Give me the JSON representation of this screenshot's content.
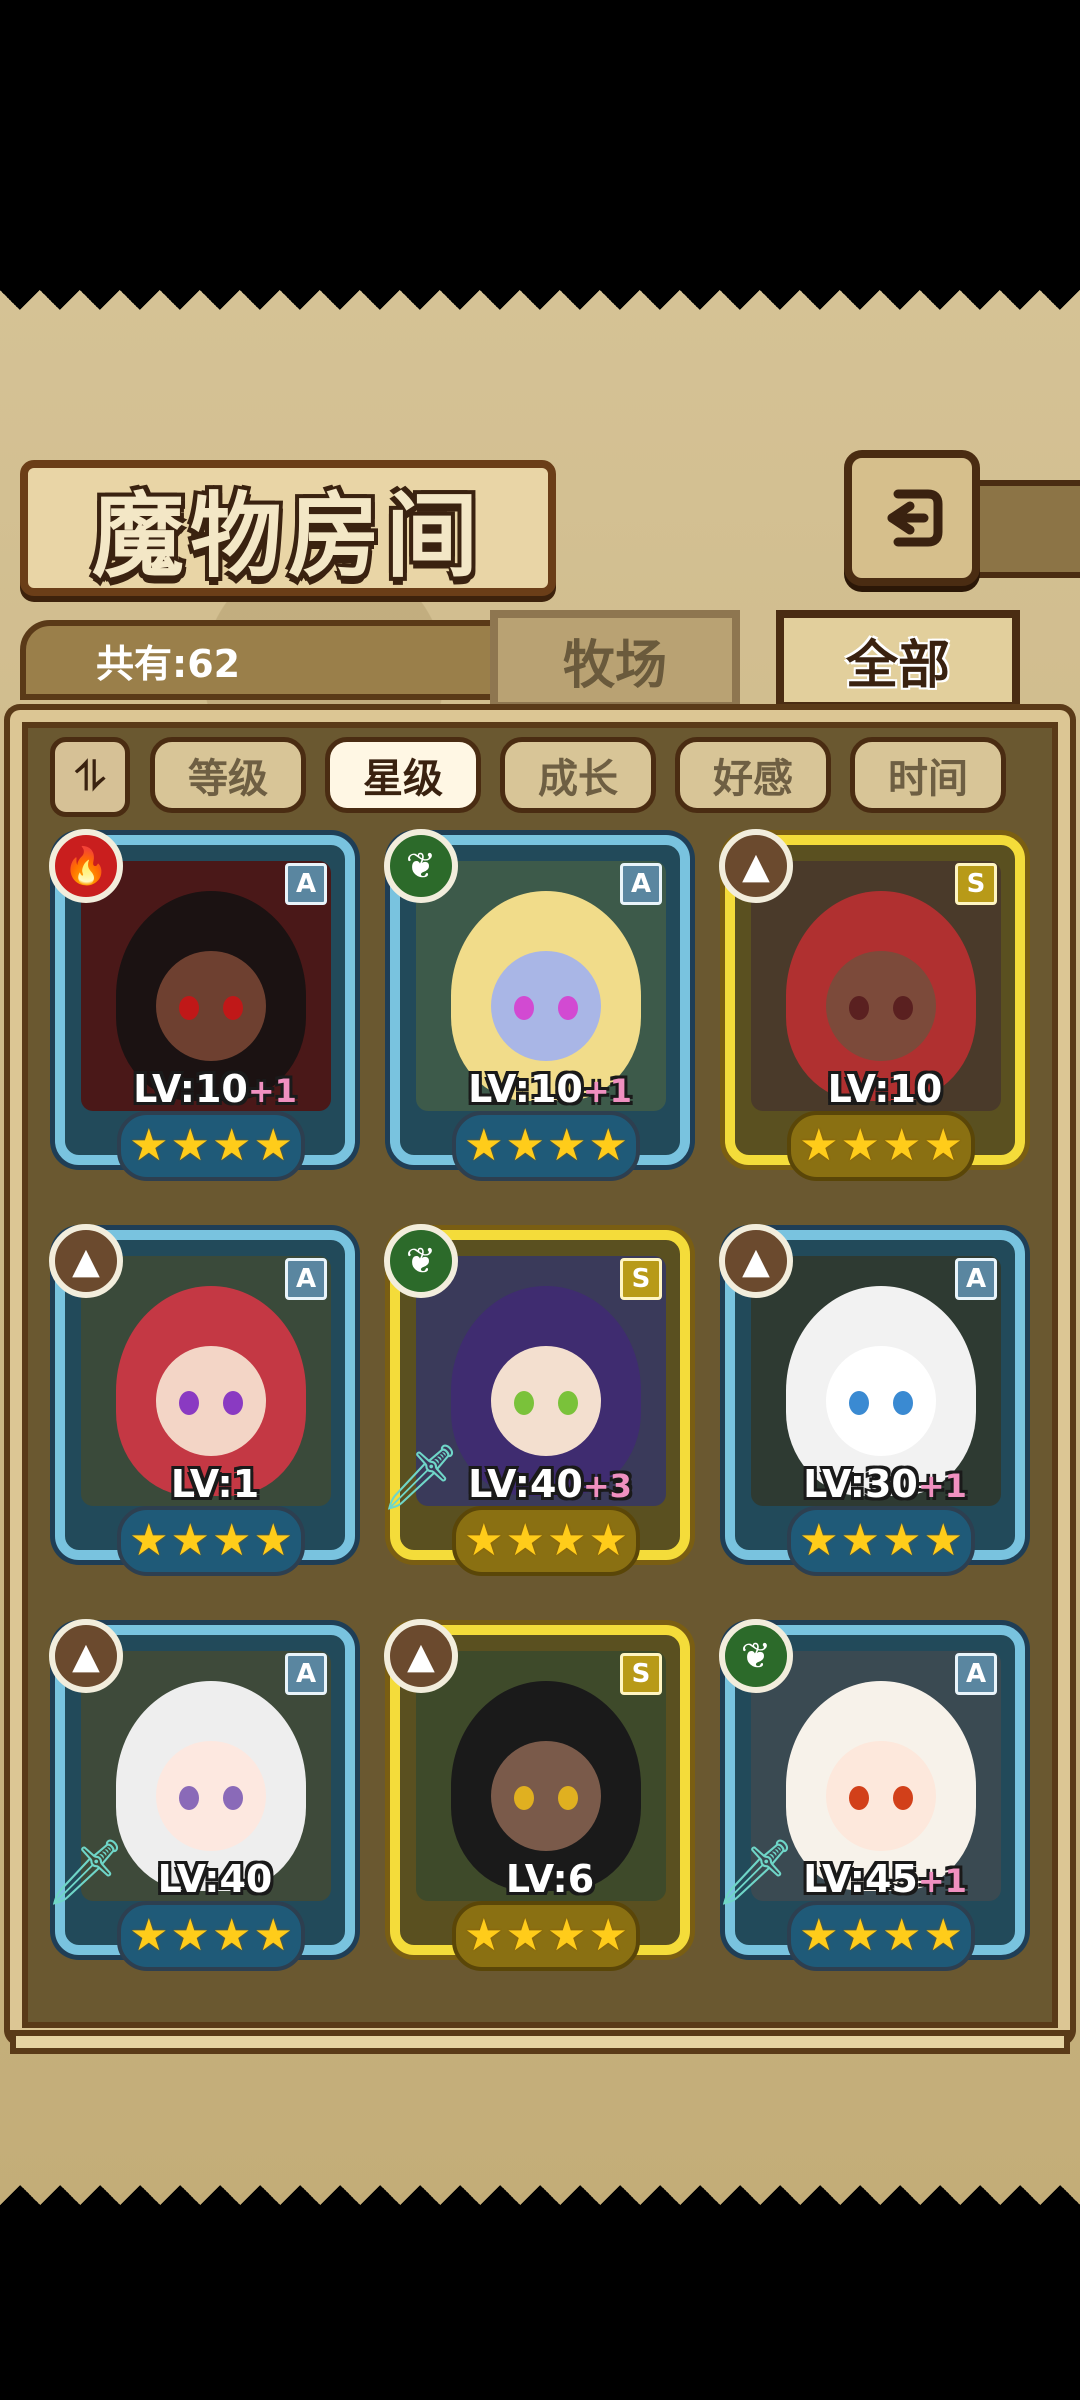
{
  "title": "魔物房间",
  "count_label": "共有:62",
  "tabs": [
    {
      "label": "牧场",
      "active": false
    },
    {
      "label": "全部",
      "active": true
    }
  ],
  "sort": {
    "toggle_icon": "sort-order-icon",
    "buttons": [
      {
        "label": "等级",
        "active": false
      },
      {
        "label": "星级",
        "active": true
      },
      {
        "label": "成长",
        "active": false
      },
      {
        "label": "好感",
        "active": false
      },
      {
        "label": "时间",
        "active": false
      }
    ]
  },
  "cards": [
    {
      "element": "fire",
      "rank": "A",
      "frame": "blue",
      "lv": "LV:10",
      "plus": "+1",
      "stars": 4,
      "weapon": false,
      "hair": "#1b1212",
      "skin": "#6e4030",
      "eye": "#c01818",
      "bg": "#4a1818"
    },
    {
      "element": "leaf",
      "rank": "A",
      "frame": "blue",
      "lv": "LV:10",
      "plus": "+1",
      "stars": 4,
      "weapon": false,
      "hair": "#f1dc8a",
      "skin": "#a9b6e6",
      "eye": "#d24ad2",
      "bg": "#3d5a4a"
    },
    {
      "element": "earth",
      "rank": "S",
      "frame": "gold",
      "lv": "LV:10",
      "plus": "",
      "stars": 4,
      "weapon": false,
      "hair": "#b03030",
      "skin": "#7c4a3a",
      "eye": "#5a2020",
      "bg": "#4a3a2a"
    },
    {
      "element": "earth",
      "rank": "A",
      "frame": "blue",
      "lv": "LV:1",
      "plus": "",
      "stars": 4,
      "weapon": false,
      "hair": "#c43844",
      "skin": "#f3d5c6",
      "eye": "#8a3ac2",
      "bg": "#3a4a3a"
    },
    {
      "element": "leaf",
      "rank": "S",
      "frame": "gold",
      "lv": "LV:40",
      "plus": "+3",
      "stars": 4,
      "weapon": true,
      "hair": "#3f2c70",
      "skin": "#f3dfcf",
      "eye": "#7ac23a",
      "bg": "#3a3a5a"
    },
    {
      "element": "earth",
      "rank": "A",
      "frame": "blue",
      "lv": "LV:30",
      "plus": "+1",
      "stars": 4,
      "weapon": false,
      "hair": "#f2f2f2",
      "skin": "#ffffff",
      "eye": "#3a8ad2",
      "bg": "#2e3a32"
    },
    {
      "element": "earth",
      "rank": "A",
      "frame": "blue",
      "lv": "LV:40",
      "plus": "",
      "stars": 4,
      "weapon": true,
      "hair": "#eeeeee",
      "skin": "#fde8e0",
      "eye": "#8a6ab8",
      "bg": "#3e4a3a"
    },
    {
      "element": "earth",
      "rank": "S",
      "frame": "gold",
      "lv": "LV:6",
      "plus": "",
      "stars": 4,
      "weapon": false,
      "hair": "#1a1a1a",
      "skin": "#7a5a4a",
      "eye": "#e0b020",
      "bg": "#3e4a2a"
    },
    {
      "element": "leaf",
      "rank": "A",
      "frame": "blue",
      "lv": "LV:45",
      "plus": "+1",
      "stars": 4,
      "weapon": true,
      "hair": "#f7f2ea",
      "skin": "#fde8dc",
      "eye": "#d2401a",
      "bg": "#3a4a52"
    }
  ]
}
